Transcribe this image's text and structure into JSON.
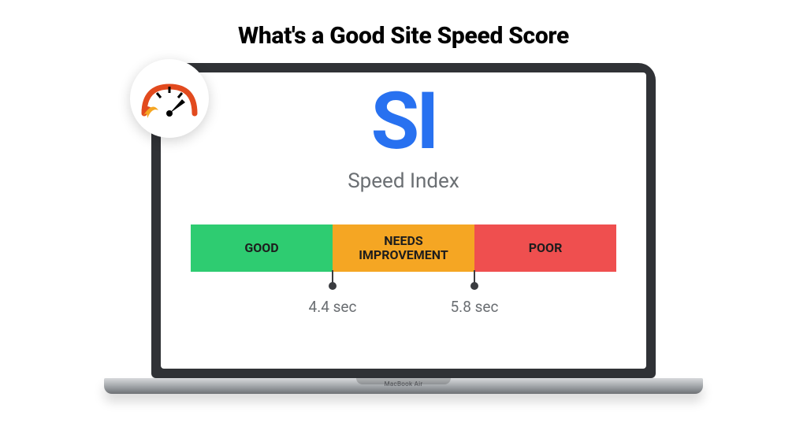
{
  "title": "What's a Good Site Speed Score",
  "metric": {
    "short": "SI",
    "label": "Speed Index"
  },
  "scale": {
    "segments": [
      {
        "label": "GOOD",
        "color": "#2ecc71"
      },
      {
        "label": "NEEDS\nIMPROVEMENT",
        "color": "#f5a623"
      },
      {
        "label": "POOR",
        "color": "#ef4f4f"
      }
    ],
    "markers": [
      {
        "label": "4.4 sec"
      },
      {
        "label": "5.8 sec"
      }
    ]
  },
  "device": {
    "brand": "MacBook Air"
  }
}
